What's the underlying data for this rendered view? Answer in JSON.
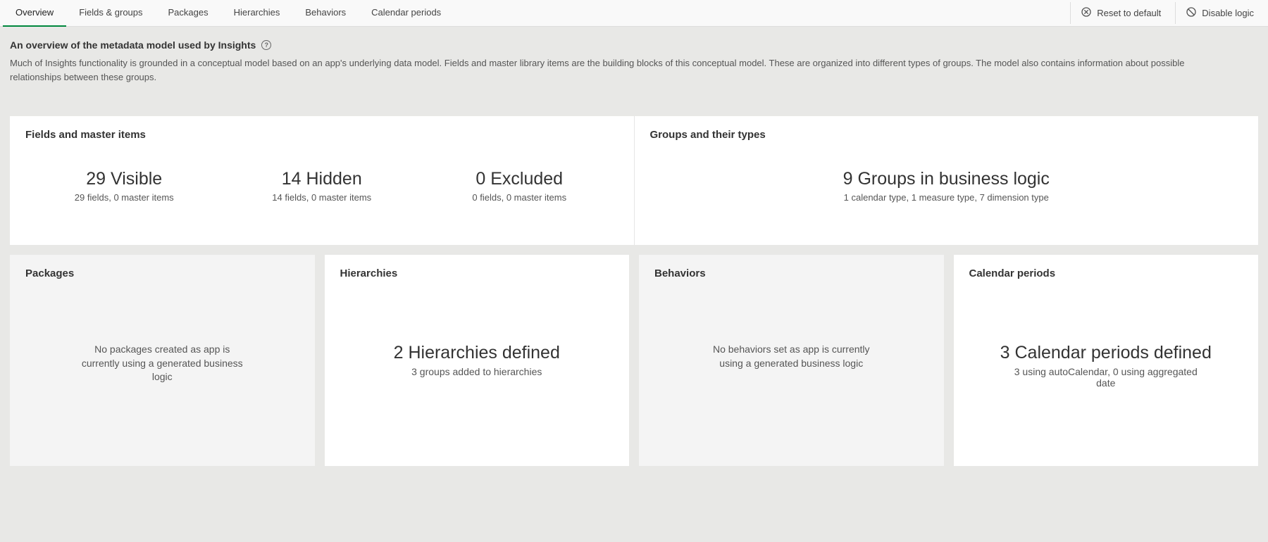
{
  "tabs": {
    "overview": "Overview",
    "fields_groups": "Fields & groups",
    "packages": "Packages",
    "hierarchies": "Hierarchies",
    "behaviors": "Behaviors",
    "calendar_periods": "Calendar periods"
  },
  "actions": {
    "reset": "Reset to default",
    "disable": "Disable logic"
  },
  "overview": {
    "title": "An overview of the metadata model used by Insights",
    "description": "Much of Insights functionality is grounded in a conceptual model based on an app's underlying data model. Fields and master library items are the building blocks of this conceptual model. These are organized into different types of groups. The model also contains information about possible relationships between these groups."
  },
  "fields_section": {
    "title": "Fields and master items",
    "visible": {
      "main": "29 Visible",
      "sub": "29 fields, 0 master items"
    },
    "hidden": {
      "main": "14 Hidden",
      "sub": "14 fields, 0 master items"
    },
    "excluded": {
      "main": "0 Excluded",
      "sub": "0 fields, 0 master items"
    }
  },
  "groups_section": {
    "title": "Groups and their types",
    "main": "9 Groups in business logic",
    "sub": "1 calendar type, 1 measure type, 7 dimension type"
  },
  "packages_card": {
    "title": "Packages",
    "empty": "No packages created as app is currently using a generated business logic"
  },
  "hierarchies_card": {
    "title": "Hierarchies",
    "main": "2 Hierarchies defined",
    "sub": "3 groups added to hierarchies"
  },
  "behaviors_card": {
    "title": "Behaviors",
    "empty": "No behaviors set as app is currently using a generated business logic"
  },
  "calendar_card": {
    "title": "Calendar periods",
    "main": "3 Calendar periods defined",
    "sub": "3 using autoCalendar, 0 using aggregated date"
  }
}
